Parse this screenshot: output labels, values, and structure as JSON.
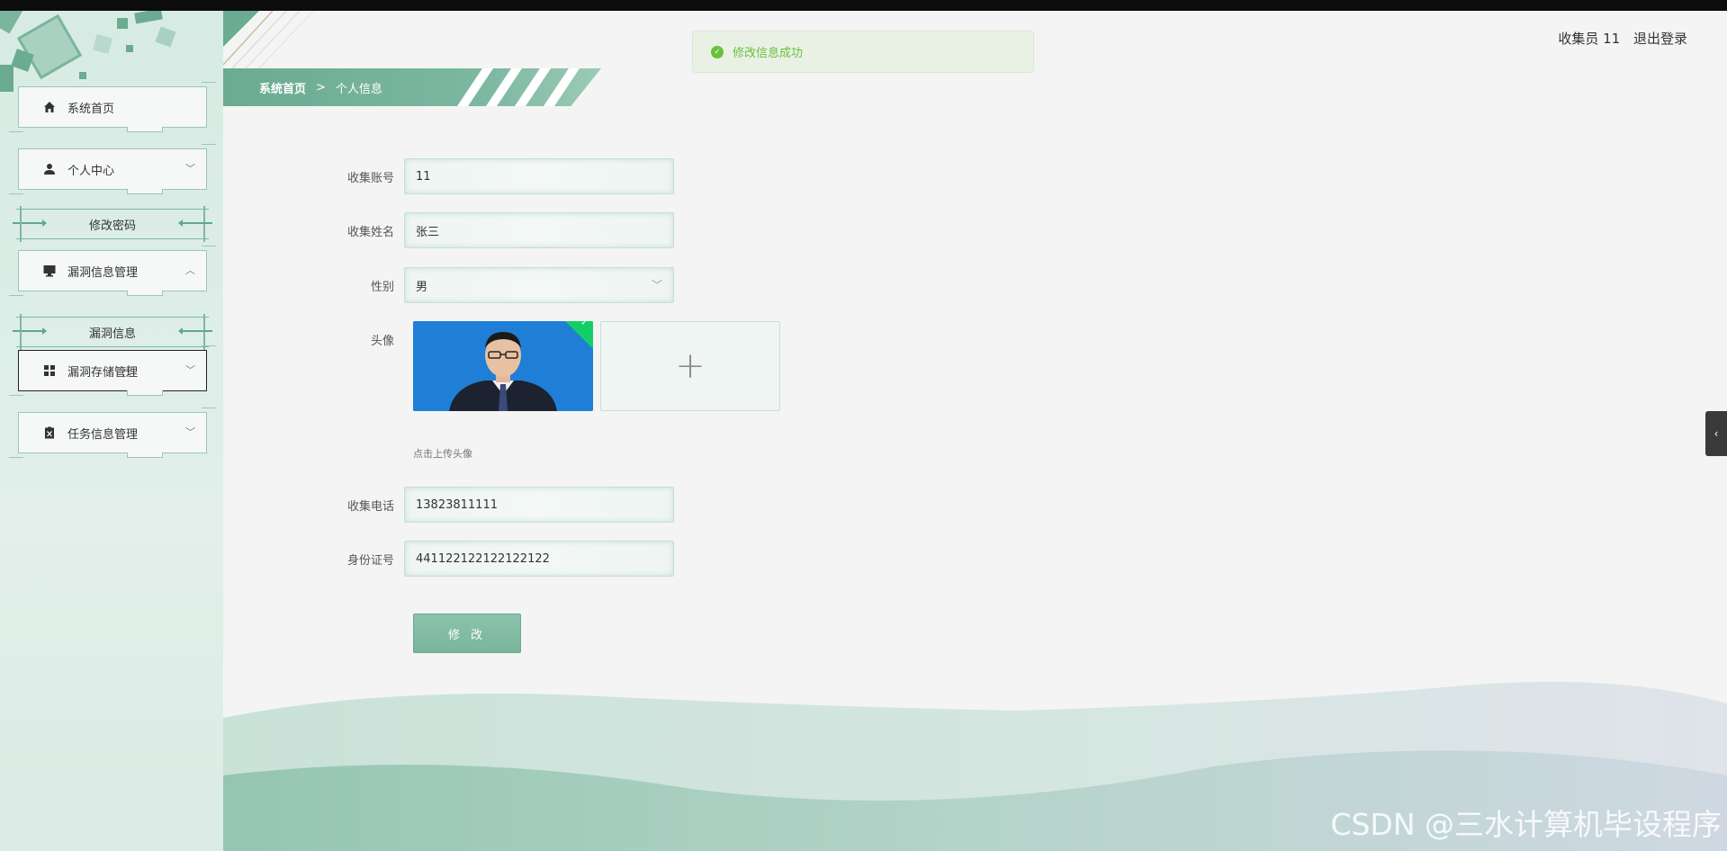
{
  "sidebar": {
    "items": [
      {
        "label": "系统首页",
        "icon": "home-icon",
        "has_chevron": false
      },
      {
        "label": "个人中心",
        "icon": "user-icon",
        "chevron": "﹀"
      },
      {
        "label": "修改密码",
        "sub": true
      },
      {
        "label": "漏洞信息管理",
        "icon": "monitor-icon",
        "chevron": "︿"
      },
      {
        "label": "漏洞信息",
        "sub": true
      },
      {
        "label": "漏洞存储管理",
        "icon": "grid-icon",
        "chevron": "﹀"
      },
      {
        "label": "任务信息管理",
        "icon": "clipboard-icon",
        "chevron": "﹀"
      }
    ]
  },
  "breadcrumb": {
    "home": "系统首页",
    "separator": ">",
    "current": "个人信息"
  },
  "header": {
    "user": "收集员 11",
    "logout": "退出登录"
  },
  "toast": {
    "message": "修改信息成功",
    "color": "#67c23a"
  },
  "form": {
    "account": {
      "label": "收集账号",
      "value": "11"
    },
    "name": {
      "label": "收集姓名",
      "value": "张三"
    },
    "gender": {
      "label": "性别",
      "value": "男"
    },
    "avatar": {
      "label": "头像",
      "plus": "+",
      "hint": "点击上传头像"
    },
    "phone": {
      "label": "收集电话",
      "value": "13823811111"
    },
    "idcard": {
      "label": "身份证号",
      "value": "441122122122122122"
    },
    "submit": "修 改"
  },
  "side_toggle": "‹",
  "watermark": "CSDN @三水计算机毕设程序",
  "colors": {
    "accent": "#6aab92",
    "sidebar_bg": "#d6ebe3",
    "success": "#67c23a"
  }
}
